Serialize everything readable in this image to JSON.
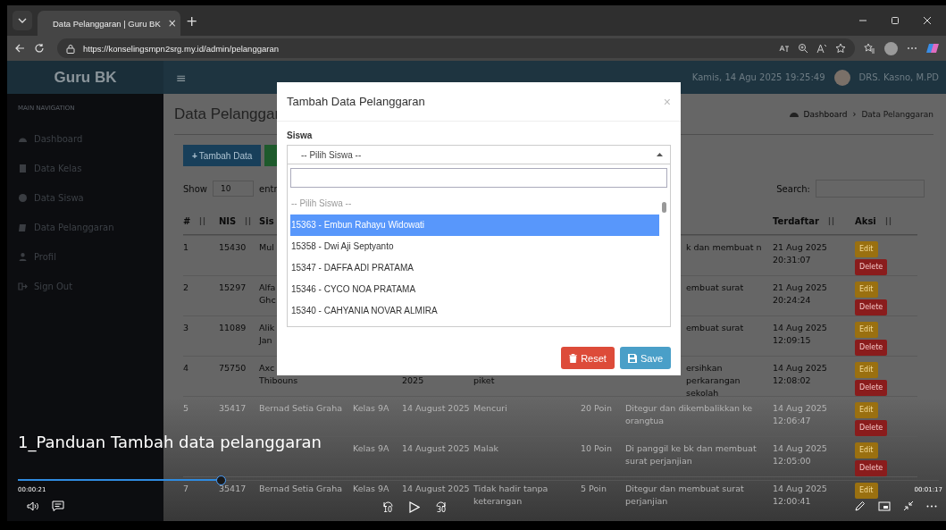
{
  "browser": {
    "tab_title": "Data Pelanggaran | Guru BK",
    "tab_close": "×",
    "new_tab": "+",
    "url": "https://konselingsmpn2srg.my.id/admin/pelanggaran"
  },
  "header": {
    "brand": "Guru BK",
    "menu": "≡",
    "datetime": "Kamis, 14 Agu 2025 19:25:49",
    "user": "DRS. Kasno, M.PD"
  },
  "sidebar": {
    "heading": "MAIN NAVIGATION",
    "items": [
      {
        "label": "Dashboard"
      },
      {
        "label": "Data Kelas"
      },
      {
        "label": "Data Siswa"
      },
      {
        "label": "Data Pelanggaran"
      },
      {
        "label": "Profil"
      },
      {
        "label": "Sign Out"
      }
    ]
  },
  "content": {
    "title": "Data Pelanggar",
    "breadcrumb": [
      "Dashboard",
      "Data Pelanggaran"
    ],
    "breadcrumb_separator": "›",
    "add_icon": "+",
    "add_button": "Tambah Data",
    "show_label": "Show",
    "page_size": "10",
    "entries_label": "entr",
    "search_label": "Search:"
  },
  "table": {
    "columns": {
      "no": "#",
      "nis": "NIS",
      "siswa": "Sis",
      "terdaftar": "Terdaftar",
      "aksi": "Aksi"
    },
    "rows": [
      {
        "no": "1",
        "nis": "15430",
        "siswa": "Mul",
        "tindakan": "k dan membuat n",
        "terdaftar": "21 Aug 2025 20:31:07",
        "edit": "Edit",
        "delete": "Delete"
      },
      {
        "no": "2",
        "nis": "15297",
        "siswa": "Alfa Ghc",
        "tindakan": "embuat surat",
        "terdaftar": "21 Aug 2025 20:24:24",
        "edit": "Edit",
        "delete": "Delete"
      },
      {
        "no": "3",
        "nis": "11089",
        "siswa": "Alik Jan",
        "tindakan": "embuat surat",
        "terdaftar": "14 Aug 2025 12:09:15",
        "edit": "Edit",
        "delete": "Delete"
      },
      {
        "no": "4",
        "nis": "75750",
        "siswa": "Axc Thibouns",
        "tanggal": "2025",
        "pelanggaran": "piket",
        "tindakan": "ersihkan perkarangan sekolah",
        "terdaftar": "14 Aug 2025 12:08:02",
        "edit": "Edit",
        "delete": "Delete"
      },
      {
        "no": "5",
        "nis": "35417",
        "siswa": "Bernad Setia Graha",
        "kelas": "Kelas 9A",
        "tanggal": "14 August 2025",
        "pelanggaran": "Mencuri",
        "poin": "20 Poin",
        "tindakan": "Ditegur dan dikembalikkan ke orangtua",
        "terdaftar": "14 Aug 2025 12:06:47",
        "edit": "Edit",
        "delete": "Delete"
      },
      {
        "kelas": "Kelas 9A",
        "tanggal": "14 August 2025",
        "pelanggaran": "Malak",
        "poin": "10 Poin",
        "tindakan": "Di panggil ke bk dan membuat surat perjanjian",
        "terdaftar": "14 Aug 2025 12:05:00",
        "edit": "Edit",
        "delete": "Delete"
      },
      {
        "no": "7",
        "nis": "35417",
        "siswa": "Bernad Setia Graha",
        "kelas": "Kelas 9A",
        "tanggal": "14 August 2025",
        "pelanggaran": "Tidak hadir tanpa keterangan",
        "poin": "5 Poin",
        "tindakan": "Ditegur dan membuat surat perjanjian",
        "terdaftar": "14 Aug 2025 12:00:41",
        "edit": "Edit"
      }
    ]
  },
  "modal": {
    "title": "Tambah Data Pelanggaran",
    "close": "×",
    "field_label": "Siswa",
    "select_value": "-- Pilih Siswa --",
    "options": [
      {
        "label": "-- Pilih Siswa --",
        "selected": false,
        "disabled": true
      },
      {
        "label": "15363 - Embun Rahayu Widowati",
        "selected": true,
        "disabled": false
      },
      {
        "label": "15358 - Dwi Aji Septyanto",
        "selected": false,
        "disabled": false
      },
      {
        "label": "15347 - DAFFA ADI PRATAMA",
        "selected": false,
        "disabled": false
      },
      {
        "label": "15346 - CYCO NOA PRATAMA",
        "selected": false,
        "disabled": false
      },
      {
        "label": "15340 - CAHYANIA NOVAR ALMIRA",
        "selected": false,
        "disabled": false
      }
    ],
    "reset_button": "Reset",
    "save_button": "Save"
  },
  "video": {
    "title": "1_Panduan Tambah data pelanggaran",
    "elapsed": "00:00:21",
    "duration": "00:01:17",
    "level": 0.22,
    "skip_back": "10",
    "skip_forward": "30"
  }
}
